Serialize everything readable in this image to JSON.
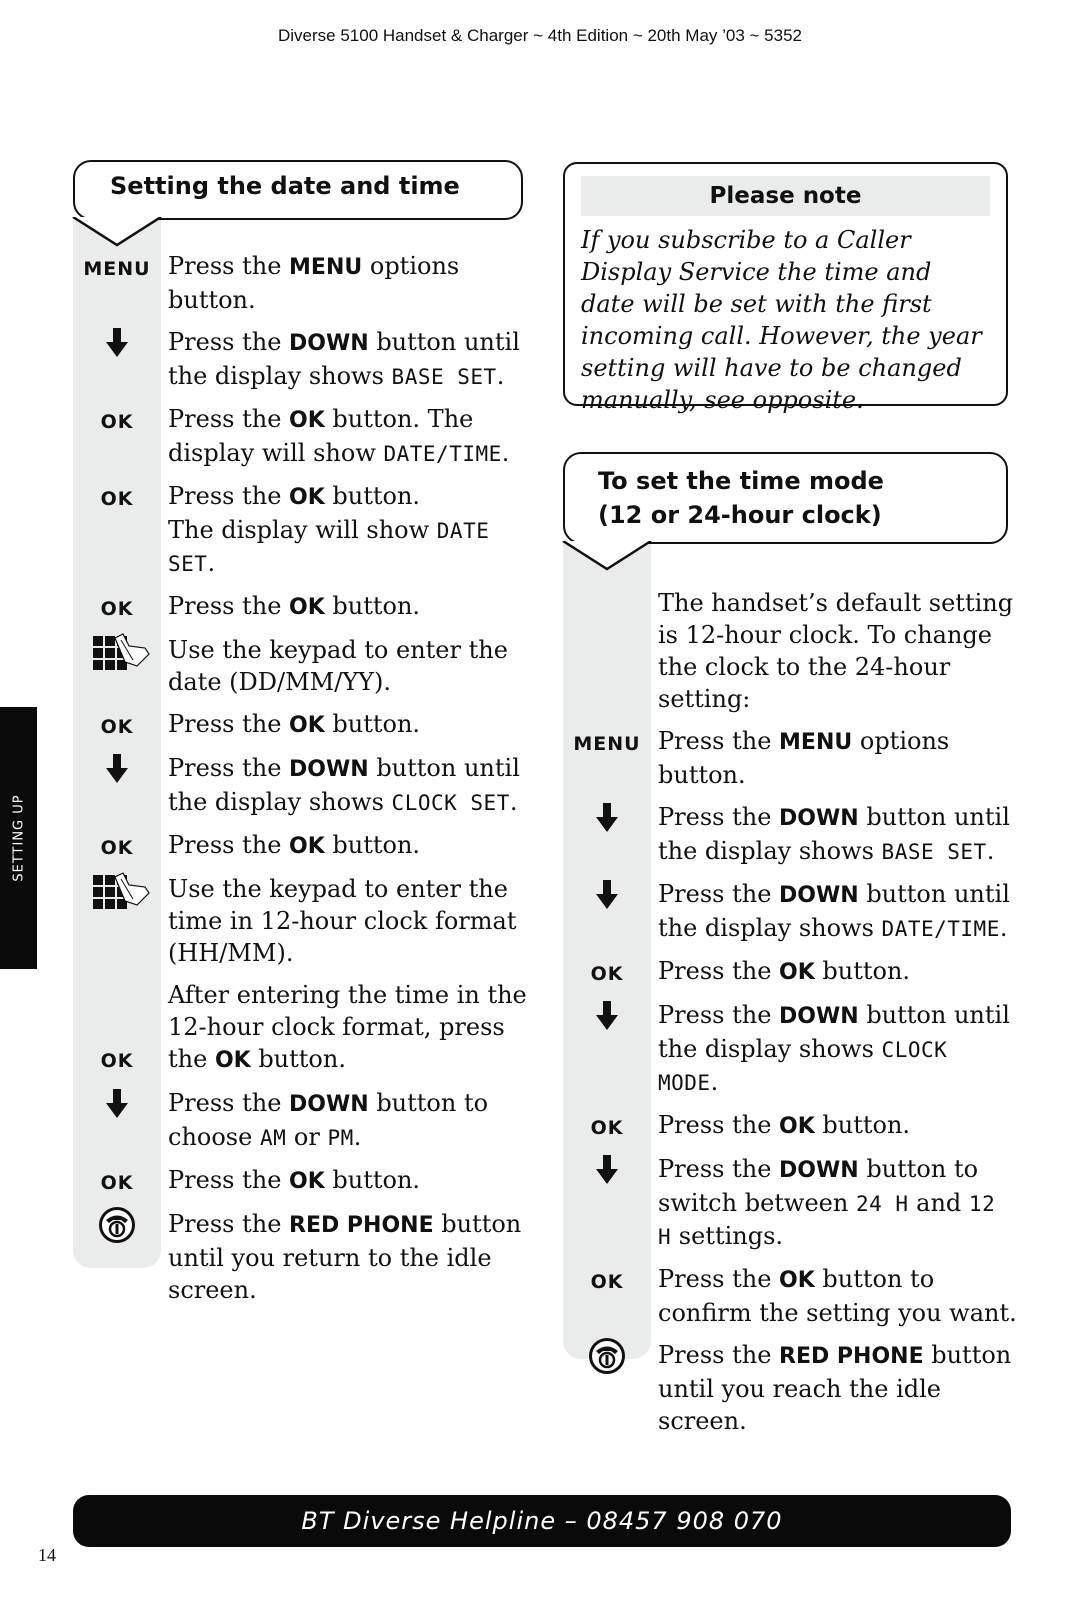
{
  "header": {
    "text": "Diverse 5100 Handset & Charger ~ 4th Edition ~ 20th May ’03 ~ 5352"
  },
  "side_tab": {
    "label": "SETTING UP"
  },
  "left_section": {
    "title": "Setting the date and time",
    "steps": [
      {
        "icon": "MENU",
        "icon_type": "text",
        "parts": [
          "Press the ",
          {
            "b": "MENU"
          },
          " options button."
        ]
      },
      {
        "icon": "down-arrow",
        "icon_type": "arrow",
        "parts": [
          "Press the ",
          {
            "b": "DOWN"
          },
          " button until the display shows ",
          {
            "lcd": "BASE SET"
          },
          "."
        ]
      },
      {
        "icon": "OK",
        "icon_type": "text",
        "parts": [
          "Press the ",
          {
            "b": "OK"
          },
          " button. The display will show ",
          {
            "lcd": "DATE/TIME"
          },
          "."
        ]
      },
      {
        "icon": "OK",
        "icon_type": "text",
        "parts": [
          "Press the ",
          {
            "b": "OK"
          },
          " button.",
          {
            "br": true
          },
          "The display will show ",
          {
            "lcd": "DATE SET"
          },
          "."
        ]
      },
      {
        "icon": "OK",
        "icon_type": "text",
        "parts": [
          "Press the ",
          {
            "b": "OK"
          },
          " button."
        ]
      },
      {
        "icon": "keypad",
        "icon_type": "keypad",
        "parts": [
          "Use the keypad to enter the date (DD/MM/YY)."
        ]
      },
      {
        "icon": "OK",
        "icon_type": "text",
        "parts": [
          "Press the ",
          {
            "b": "OK"
          },
          " button."
        ]
      },
      {
        "icon": "down-arrow",
        "icon_type": "arrow",
        "parts": [
          "Press the ",
          {
            "b": "DOWN"
          },
          " button until the display shows ",
          {
            "lcd": "CLOCK SET"
          },
          "."
        ]
      },
      {
        "icon": "OK",
        "icon_type": "text",
        "parts": [
          "Press the ",
          {
            "b": "OK"
          },
          " button."
        ]
      },
      {
        "icon": "keypad",
        "icon_type": "keypad",
        "parts": [
          "Use the keypad to enter the time in 12-hour clock format (HH/MM)."
        ]
      },
      {
        "icon": "OK",
        "icon_type": "text",
        "icon_align": "bottom",
        "parts": [
          "After entering the time in the 12-hour clock format, press the ",
          {
            "b": "OK"
          },
          " button."
        ]
      },
      {
        "icon": "down-arrow",
        "icon_type": "arrow",
        "parts": [
          "Press the ",
          {
            "b": "DOWN"
          },
          " button to choose ",
          {
            "lcd": "AM"
          },
          " or ",
          {
            "lcd": "PM"
          },
          "."
        ]
      },
      {
        "icon": "OK",
        "icon_type": "text",
        "parts": [
          "Press the ",
          {
            "b": "OK"
          },
          " button."
        ]
      },
      {
        "icon": "red-phone",
        "icon_type": "phone",
        "parts": [
          "Press the ",
          {
            "b": "RED PHONE"
          },
          " button until you return to the idle screen."
        ]
      }
    ]
  },
  "note": {
    "title": "Please note",
    "body": "If you subscribe to a Caller Display Service the time and date will be set with the first incoming call. However, the year setting will have to be changed manually, see opposite."
  },
  "right_section": {
    "title_line1": "To set the time mode",
    "title_line2": "(12 or 24-hour clock)",
    "steps": [
      {
        "icon": "",
        "icon_type": "none",
        "parts": [
          "The handset’s default setting is 12-hour clock. To change the clock to the 24-hour setting:"
        ]
      },
      {
        "icon": "MENU",
        "icon_type": "text",
        "parts": [
          "Press the ",
          {
            "b": "MENU"
          },
          " options button."
        ]
      },
      {
        "icon": "down-arrow",
        "icon_type": "arrow",
        "parts": [
          "Press the ",
          {
            "b": "DOWN"
          },
          " button until the display shows ",
          {
            "lcd": "BASE SET"
          },
          "."
        ]
      },
      {
        "icon": "down-arrow",
        "icon_type": "arrow",
        "parts": [
          "Press the ",
          {
            "b": "DOWN"
          },
          " button until the display shows ",
          {
            "lcd": "DATE/TIME"
          },
          "."
        ]
      },
      {
        "icon": "OK",
        "icon_type": "text",
        "parts": [
          "Press the ",
          {
            "b": "OK"
          },
          " button."
        ]
      },
      {
        "icon": "down-arrow",
        "icon_type": "arrow",
        "parts": [
          "Press the ",
          {
            "b": "DOWN"
          },
          " button until the display shows ",
          {
            "lcd": "CLOCK MODE"
          },
          "."
        ]
      },
      {
        "icon": "OK",
        "icon_type": "text",
        "parts": [
          "Press the ",
          {
            "b": "OK"
          },
          " button."
        ]
      },
      {
        "icon": "down-arrow",
        "icon_type": "arrow",
        "parts": [
          "Press the ",
          {
            "b": "DOWN"
          },
          " button to switch between ",
          {
            "lcd": "24 H"
          },
          " and ",
          {
            "lcd": "12 H"
          },
          " settings."
        ]
      },
      {
        "icon": "OK",
        "icon_type": "text",
        "parts": [
          "Press the ",
          {
            "b": "OK"
          },
          " button to confirm the setting you want."
        ]
      },
      {
        "icon": "red-phone",
        "icon_type": "phone",
        "parts": [
          "Press the ",
          {
            "b": "RED PHONE"
          },
          " button until you reach the idle screen."
        ]
      }
    ]
  },
  "footer": {
    "helpline": "BT Diverse Helpline – 08457 908 070",
    "page_number": "14"
  }
}
